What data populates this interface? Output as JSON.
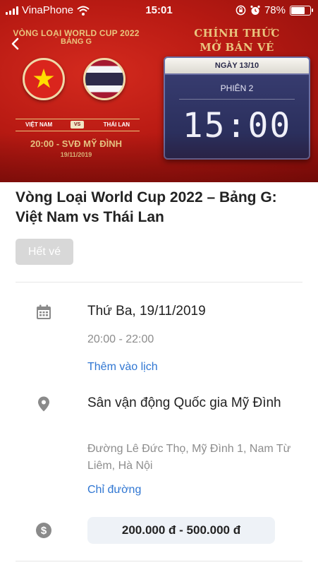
{
  "status_bar": {
    "carrier": "VinaPhone",
    "time": "15:01",
    "battery": "78%",
    "battery_level": 0.78
  },
  "banner": {
    "title_line1": "VÒNG LOẠI WORLD CUP 2022",
    "title_line2": "BẢNG G",
    "team_home": "VIỆT NAM",
    "vs": "VS",
    "team_away": "THÁI LAN",
    "match_info": "20:00 - SVĐ MỸ ĐÌNH",
    "match_date": "19/11/2019",
    "official_line1": "CHÍNH THỨC",
    "official_line2": "MỞ BÁN VÉ",
    "board_date": "NGÀY 13/10",
    "board_session": "PHIÊN 2",
    "board_time": "15:00"
  },
  "event": {
    "title": "Vòng Loại World Cup 2022 – Bảng G: Việt Nam vs Thái Lan",
    "status_badge": "Hết vé",
    "date": "Thứ Ba, 19/11/2019",
    "time_range": "20:00 - 22:00",
    "add_calendar": "Thêm vào lịch",
    "venue": "Sân vận động Quốc gia Mỹ Đình",
    "address": "Đường Lê Đức Thọ, Mỹ Đình 1, Nam Từ Liêm, Hà Nội",
    "directions": "Chỉ đường",
    "price": "200.000 đ - 500.000 đ"
  },
  "colors": {
    "banner_red": "#c41f16",
    "gold": "#e9c57e",
    "link_blue": "#2f76d2",
    "icon_gray": "#8a8a8a"
  },
  "icons": [
    "wifi-icon",
    "lock-rotation-icon",
    "alarm-icon",
    "back-chevron-icon",
    "calendar-icon",
    "location-pin-icon",
    "dollar-icon"
  ]
}
